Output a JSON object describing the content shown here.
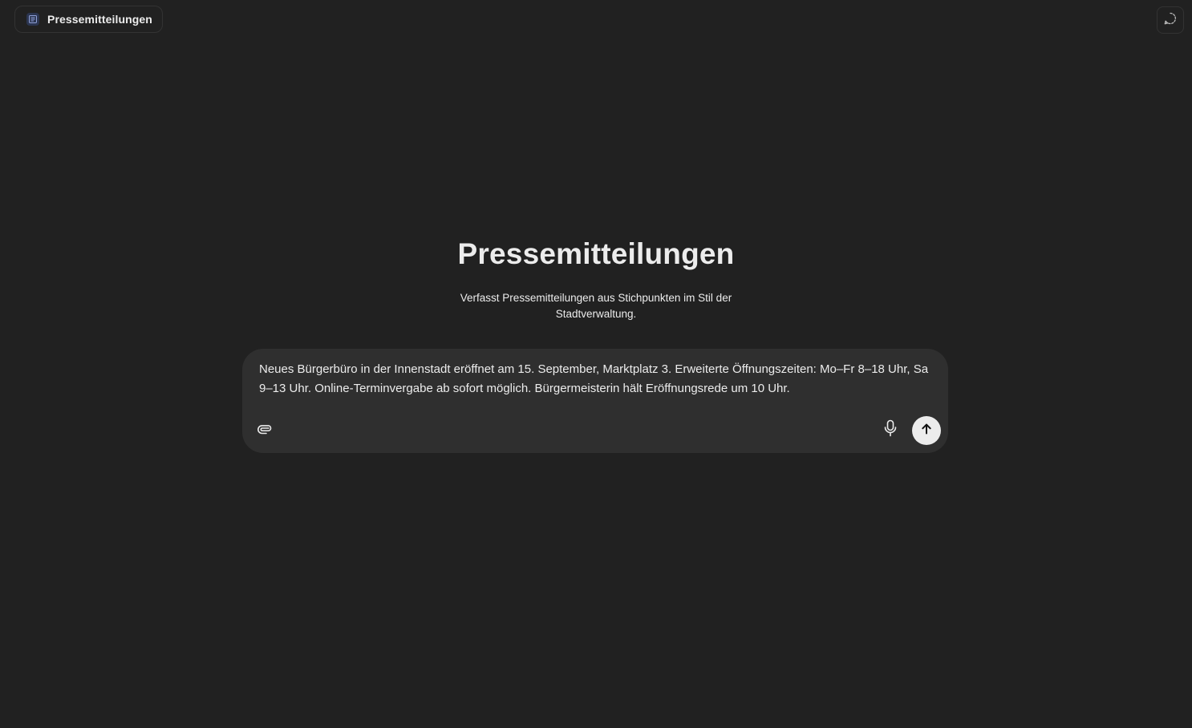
{
  "header": {
    "gpt_name": "Pressemitteilungen",
    "gpt_icon": "document-icon",
    "corner_icon": "new-chat-dashed-icon"
  },
  "hero": {
    "title": "Pressemitteilungen",
    "description": "Verfasst Pressemitteilungen aus Stichpunkten im Stil der Stadtverwaltung."
  },
  "composer": {
    "text": "Neues Bürgerbüro in der Innenstadt eröffnet am 15. September, Marktplatz 3. Erweiterte Öffnungszeiten: Mo–Fr 8–18 Uhr, Sa 9–13 Uhr. Online-Terminvergabe ab sofort möglich. Bürgermeisterin hält Eröffnungsrede um 10 Uhr.",
    "attach_icon": "paperclip-icon",
    "mic_icon": "microphone-icon",
    "send_icon": "arrow-up-icon"
  },
  "colors": {
    "background": "#212121",
    "composer_bg": "#2f2f2f",
    "text": "#ececec",
    "send_bg": "#ececec"
  }
}
